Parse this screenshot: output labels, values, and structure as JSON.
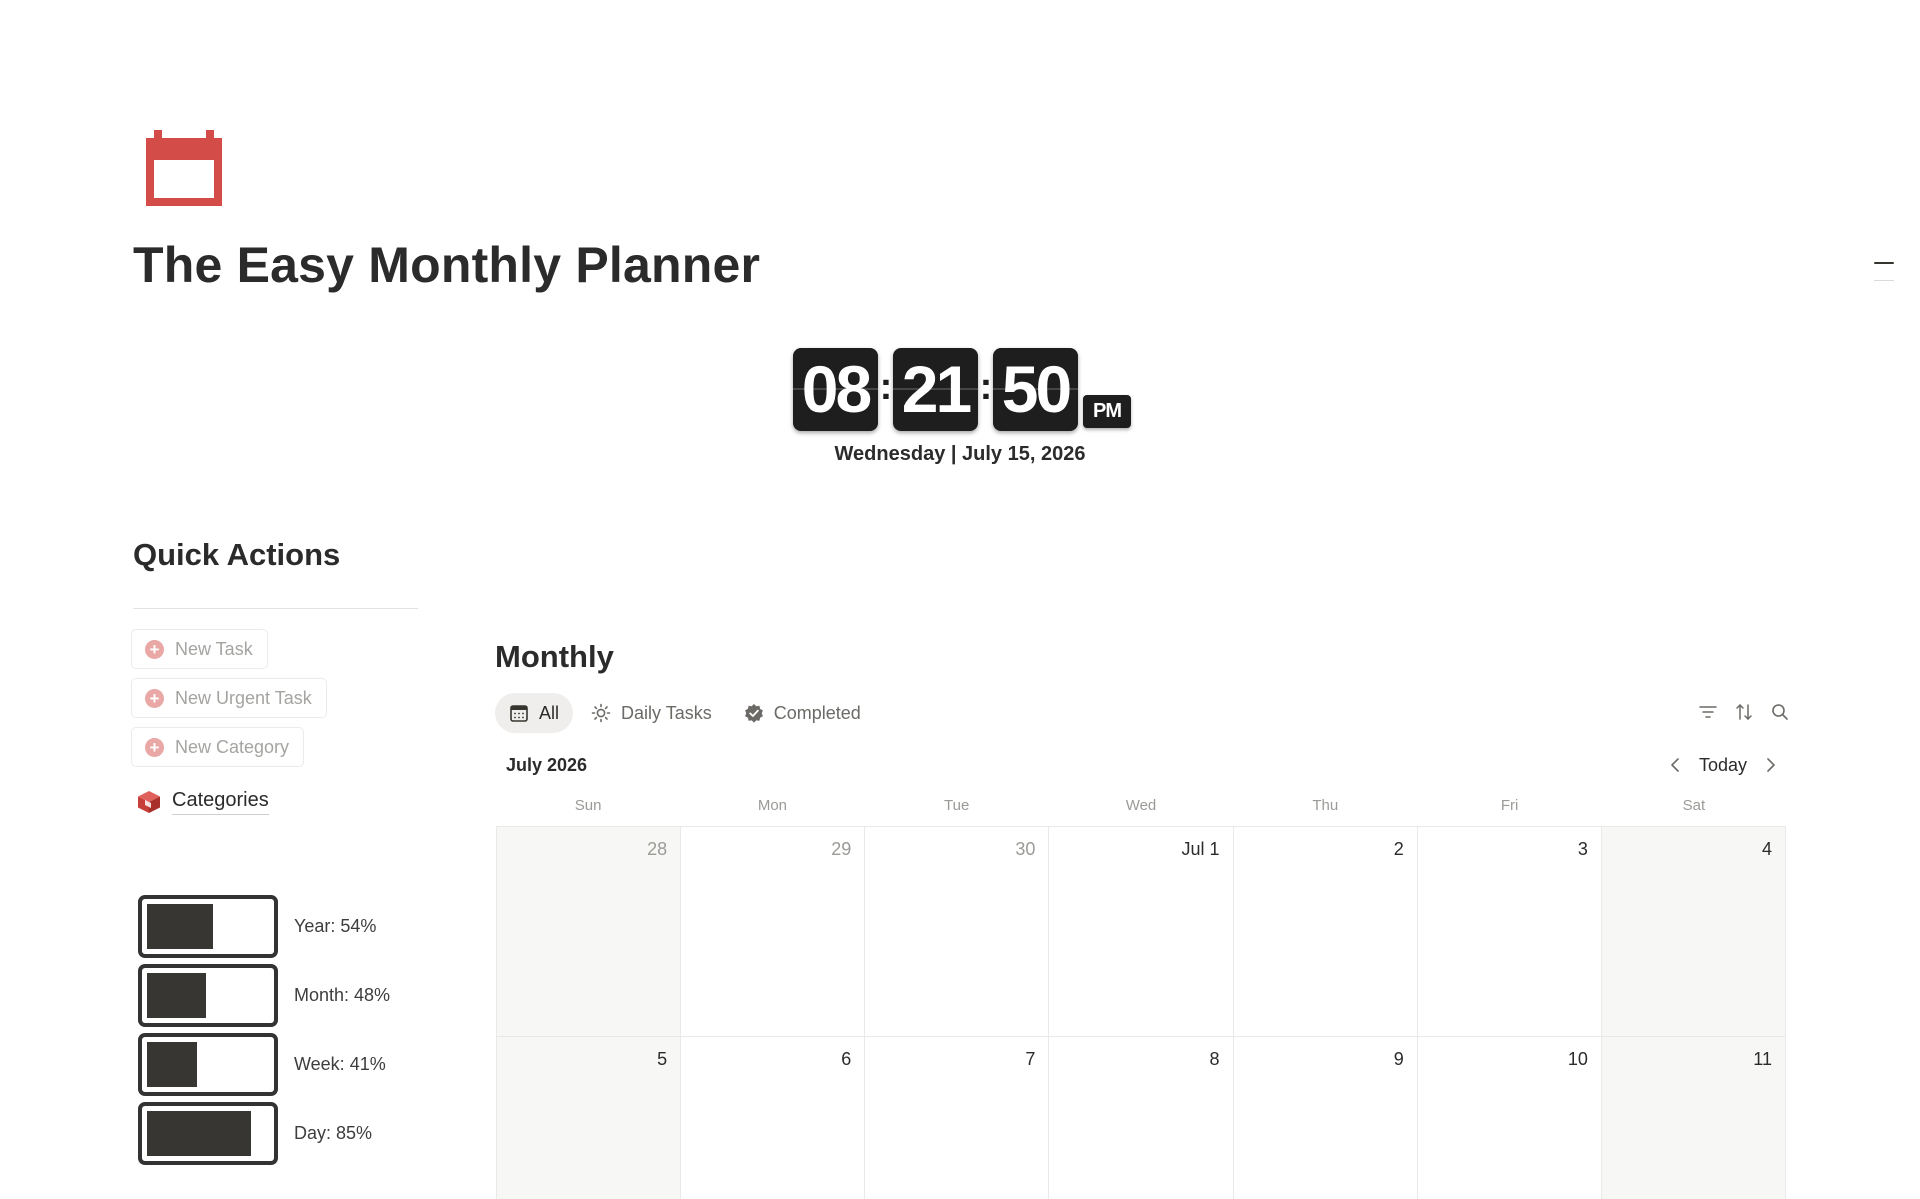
{
  "page": {
    "title": "The Easy Monthly Planner",
    "icon": "calendar-icon",
    "icon_color": "#d44c47"
  },
  "clock": {
    "hours": "08",
    "minutes": "21",
    "seconds": "50",
    "ampm": "PM",
    "separator": ":",
    "date": "Wednesday | July 15, 2026"
  },
  "quick_actions": {
    "heading": "Quick Actions",
    "buttons": [
      {
        "label": "New Task",
        "icon": "plus-circle-icon"
      },
      {
        "label": "New Urgent Task",
        "icon": "plus-circle-icon"
      },
      {
        "label": "New Category",
        "icon": "plus-circle-icon"
      }
    ],
    "plus_glyph": "+",
    "categories_link": {
      "label": "Categories",
      "icon": "cube-icon"
    }
  },
  "progress": [
    {
      "label": "Year: 54%",
      "value": 0.54
    },
    {
      "label": "Month: 48%",
      "value": 0.48
    },
    {
      "label": "Week: 41%",
      "value": 0.41
    },
    {
      "label": "Day: 85%",
      "value": 0.85
    }
  ],
  "monthly": {
    "title": "Monthly",
    "tabs": [
      {
        "label": "All",
        "icon": "calendar-grid-icon",
        "active": true
      },
      {
        "label": "Daily Tasks",
        "icon": "sun-icon",
        "active": false
      },
      {
        "label": "Completed",
        "icon": "verified-check-icon",
        "active": false
      }
    ],
    "tools": [
      "filter-icon",
      "sort-icon",
      "search-icon"
    ],
    "calendar": {
      "month_label": "July 2026",
      "today_label": "Today",
      "weekdays": [
        "Sun",
        "Mon",
        "Tue",
        "Wed",
        "Thu",
        "Fri",
        "Sat"
      ],
      "weeks": [
        [
          {
            "label": "28",
            "outside": true
          },
          {
            "label": "29",
            "outside": true
          },
          {
            "label": "30",
            "outside": true
          },
          {
            "label": "Jul 1",
            "outside": false
          },
          {
            "label": "2",
            "outside": false
          },
          {
            "label": "3",
            "outside": false
          },
          {
            "label": "4",
            "outside": false
          }
        ],
        [
          {
            "label": "5",
            "outside": false
          },
          {
            "label": "6",
            "outside": false
          },
          {
            "label": "7",
            "outside": false
          },
          {
            "label": "8",
            "outside": false
          },
          {
            "label": "9",
            "outside": false
          },
          {
            "label": "10",
            "outside": false
          },
          {
            "label": "11",
            "outside": false
          }
        ]
      ]
    }
  }
}
